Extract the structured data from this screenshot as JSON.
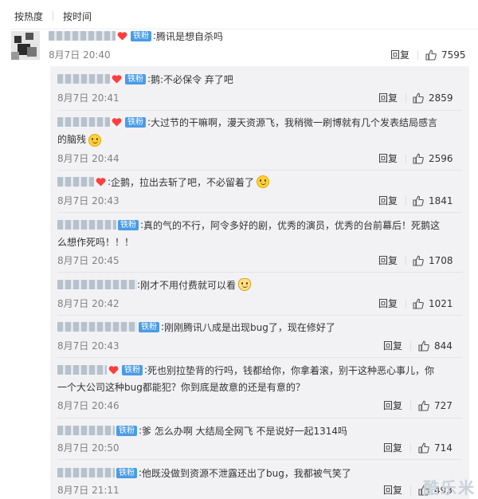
{
  "sort_tabs": [
    "按热度",
    "按时间"
  ],
  "reply_label": "回复",
  "colors": {
    "badge": "#4a9ce6",
    "heart": "#ff3d3d",
    "username_blur": "#b7c1cc"
  },
  "badge_text": "铁粉",
  "main_comment": {
    "username": "____8",
    "text": "腾讯是想自杀吗",
    "time": "8月7日 20:40",
    "likes": "7595"
  },
  "replies": [
    {
      "username": "_ss",
      "text": "鹅:不必保令 弃了吧",
      "time": "8月7日 20:41",
      "likes": "2859"
    },
    {
      "username": "s",
      "text_line1": "大过节的干嘛啊，漫天资源飞，我稍微一刷博就有几个发表结局感言",
      "text_line2": "的脑残",
      "emoji": "smile-emoji",
      "time": "8月7日 20:44",
      "likes": "2596"
    },
    {
      "username": "Hirosh",
      "text": "企鹅，拉出去斩了吧，不必留着了",
      "emoji": "smile-emoji",
      "time": "8月7日 20:43",
      "likes": "1841"
    },
    {
      "username": "",
      "text_line1": "真的气的不行，阿令多好的剧，优秀的演员，优秀的台前幕后！死鹅这",
      "text_line2": "么想作死吗！！！",
      "time": "8月7日 20:45",
      "likes": "1708"
    },
    {
      "username": "",
      "text": "刚才不用付费就可以看",
      "emoji": "cat-emoji",
      "time": "8月7日 20:42",
      "likes": "1021"
    },
    {
      "username": "",
      "text": "刚刚腾讯八成是出现bug了，现在修好了",
      "time": "8月7日 20:43",
      "likes": "844"
    },
    {
      "username": "",
      "text_line1": "死也别拉垫背的行吗，钱都给你，你拿着滚，别干这种恶心事儿，你",
      "text_line2": "一个大公司这种bug都能犯？你到底是故意的还是有意的？",
      "time": "8月7日 20:46",
      "likes": "727"
    },
    {
      "username": "",
      "text": "爹 怎么办啊 大结局全网飞 不是说好一起1314吗",
      "time": "8月7日 20:50",
      "likes": "714"
    },
    {
      "username": "",
      "text": "他既没做到资源不泄露还出了bug，我都被气笑了",
      "time": "8月7日 21:11",
      "likes": "493"
    }
  ],
  "watermark": "酷乐米"
}
